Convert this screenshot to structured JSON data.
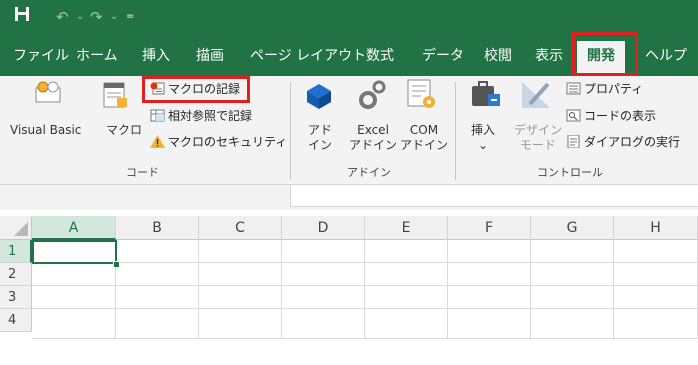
{
  "qat": {
    "save_icon": "floppy-disk-icon",
    "undo_icon": "undo-icon",
    "redo_icon": "redo-icon",
    "customize_icon": "dropdown-icon"
  },
  "tabs": [
    {
      "label": "ファイル"
    },
    {
      "label": "ホーム"
    },
    {
      "label": "挿入"
    },
    {
      "label": "描画"
    },
    {
      "label": "ページ レイアウト"
    },
    {
      "label": "数式"
    },
    {
      "label": "データ"
    },
    {
      "label": "校閲"
    },
    {
      "label": "表示"
    },
    {
      "label": "開発"
    },
    {
      "label": "ヘルプ"
    }
  ],
  "active_tab": "開発",
  "highlight_color": "#e02020",
  "accent_color": "#217346",
  "ribbon": {
    "code": {
      "group_label": "コード",
      "visual_basic": "Visual Basic",
      "macro": "マクロ",
      "record_macro": "マクロの記録",
      "relative_ref": "相対参照で記録",
      "macro_security": "マクロのセキュリティ"
    },
    "addins": {
      "group_label": "アドイン",
      "addin": [
        "アド",
        "イン"
      ],
      "excel_addin": [
        "Excel",
        "アドイン"
      ],
      "com_addin": [
        "COM",
        "アドイン"
      ]
    },
    "controls": {
      "group_label": "コントロール",
      "insert": "挿入",
      "insert_arrow": "⌄",
      "design_mode": [
        "デザイン",
        "モード"
      ],
      "properties": "プロパティ",
      "view_code": "コードの表示",
      "run_dialog": "ダイアログの実行"
    }
  },
  "grid": {
    "columns": [
      "A",
      "B",
      "C",
      "D",
      "E",
      "F",
      "G",
      "H"
    ],
    "rows": [
      "1",
      "2",
      "3",
      "4"
    ],
    "selected_cell": "A1"
  }
}
